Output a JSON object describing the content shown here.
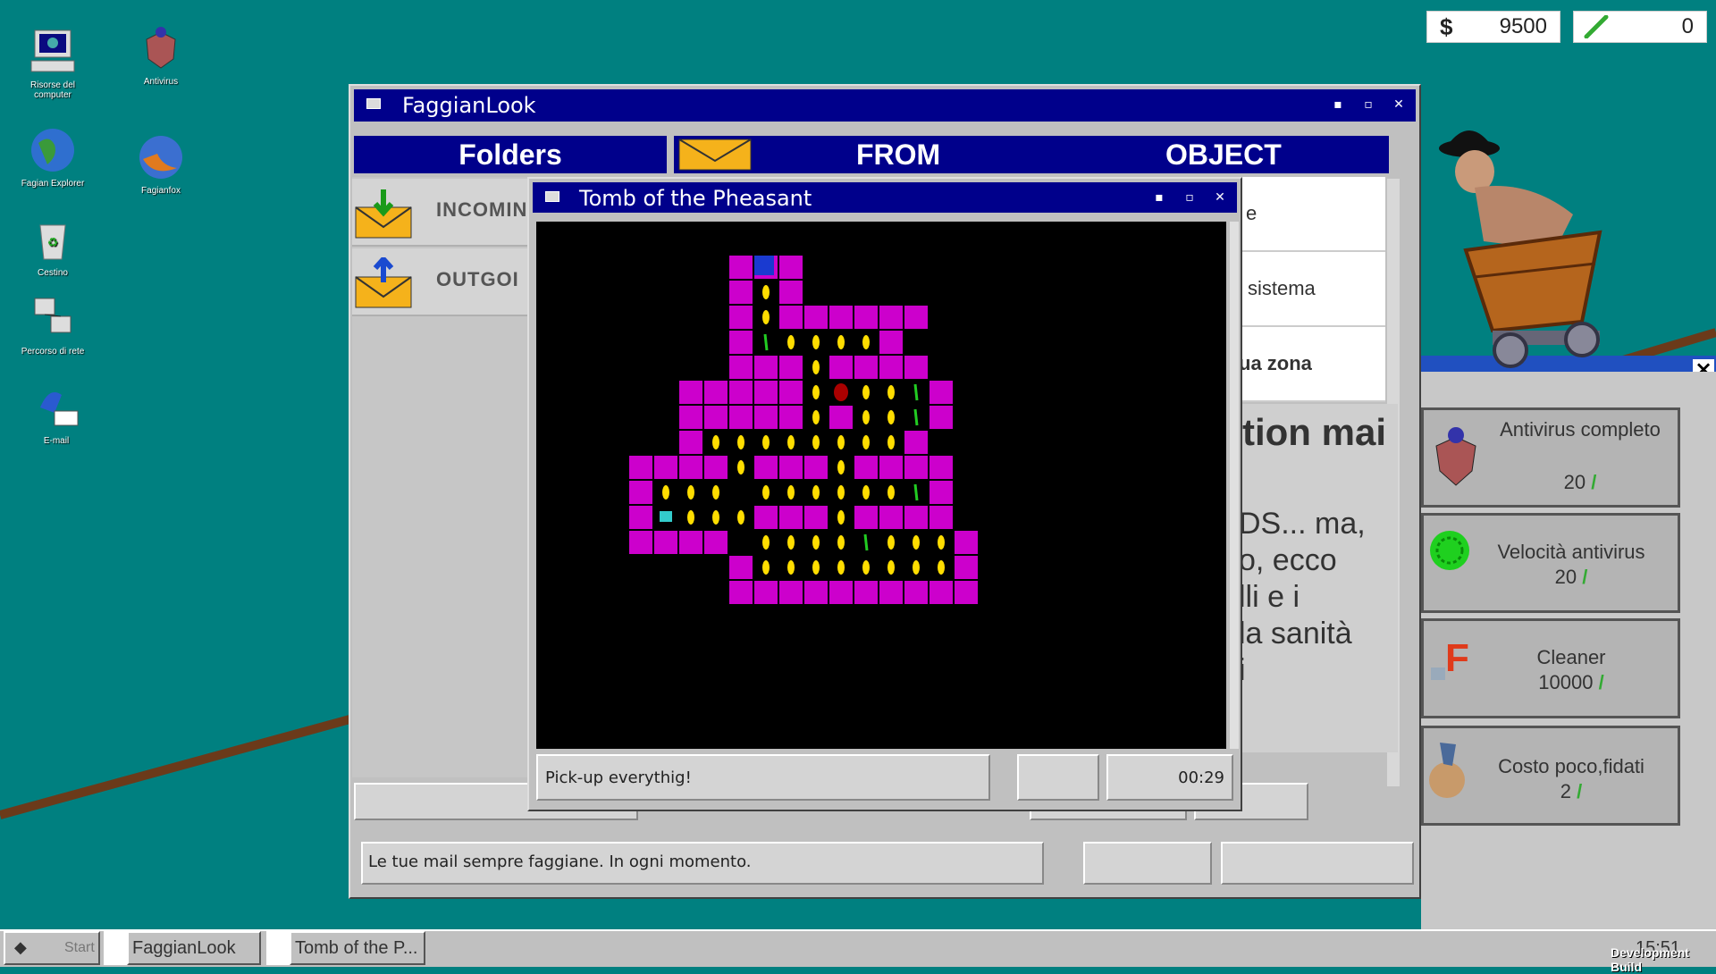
{
  "desktop": {
    "icons": [
      {
        "label": "Risorse del computer",
        "icon": "computer-icon"
      },
      {
        "label": "Antivirus",
        "icon": "antivirus-shield-icon"
      },
      {
        "label": "Fagian Explorer",
        "icon": "globe-icon"
      },
      {
        "label": "Fagianfox",
        "icon": "fagianfox-icon"
      },
      {
        "label": "Cestino",
        "icon": "recycle-bin-icon"
      },
      {
        "label": "Percorso di rete",
        "icon": "network-icon"
      },
      {
        "label": "E-mail",
        "icon": "email-icon"
      }
    ]
  },
  "counters": {
    "money": "9500",
    "feathers": "0"
  },
  "mail_window": {
    "title": "FaggianLook",
    "headers": {
      "folders": "Folders",
      "from": "FROM",
      "object": "OBJECT"
    },
    "folders": [
      {
        "label": "INCOMIN",
        "icon": "inbox-arrow-icon"
      },
      {
        "label": "OUTGOI",
        "icon": "outbox-arrow-icon"
      }
    ],
    "rows": [
      "e",
      "sistema",
      "ua zona"
    ],
    "preview_title": "tion mai",
    "preview_lines": [
      "DS... ma,",
      "o, ecco",
      "lli e i",
      "la sanità",
      "i"
    ],
    "status": "Le tue mail sempre faggiane. In ogni momento."
  },
  "game_window": {
    "title": "Tomb of the Pheasant",
    "status_message": "Pick-up everythig!",
    "timer": "00:29"
  },
  "shop": {
    "items": [
      {
        "name": "Antivirus completo",
        "price": "20",
        "icon": "antivirus-shield-icon"
      },
      {
        "name": "Velocità antivirus",
        "price": "20",
        "icon": "speed-virus-icon"
      },
      {
        "name": "Cleaner",
        "price": "10000",
        "icon": "cleaner-icon"
      },
      {
        "name": "Costo poco,fidati",
        "price": "2",
        "icon": "pheasant-coin-icon"
      }
    ],
    "close": "×"
  },
  "taskbar": {
    "start": "Start",
    "tasks": [
      "FaggianLook",
      "Tomb of the P..."
    ],
    "clock": "15:51",
    "build": "Development Build"
  },
  "colors": {
    "desktop": "#008080",
    "titlebar": "#00008b",
    "maze_wall": "#cc00cc",
    "coin": "#ffdd00",
    "feather": "#22cc22"
  }
}
